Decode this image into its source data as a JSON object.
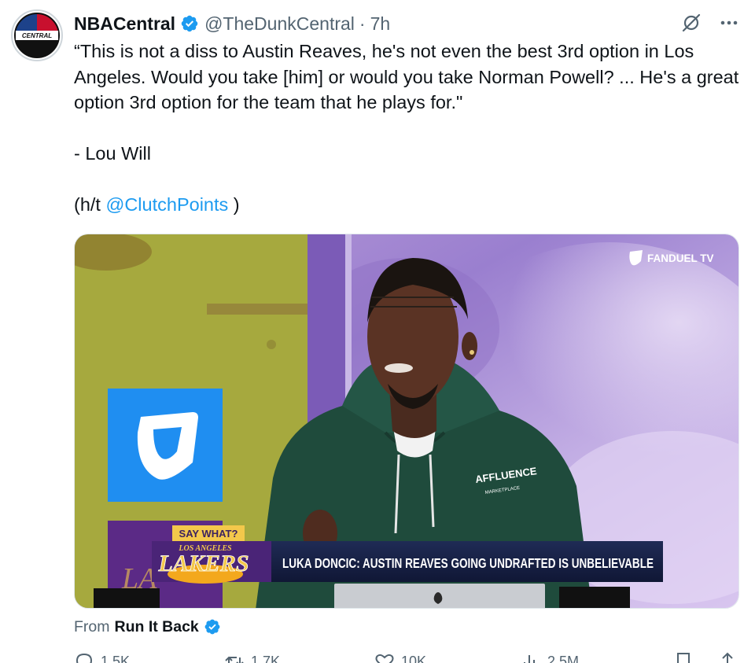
{
  "post": {
    "author_name": "NBACentral",
    "author_handle": "@TheDunkCentral",
    "separator": "·",
    "time": "7h",
    "avatar_text": "CENTRAL",
    "quote_text": "“This is not a diss to Austin Reaves, he's not even the best 3rd option in Los Angeles. Would you take [him] or would you take Norman Powell? ... He's a great option 3rd option for the team that he plays for.\"",
    "attribution": "- Lou Will",
    "ht_prefix": "(h/t ",
    "ht_mention": "@ClutchPoints",
    "ht_suffix": " )"
  },
  "media": {
    "brand_watermark": "FANDUEL TV",
    "hoodie_text": "AFFLUENCE",
    "hoodie_subtext": "MARKETPLACE",
    "lower_third_kicker": "SAY WHAT?",
    "team_logo_top": "LOS ANGELES",
    "team_logo_main": "LAKERS",
    "headline": "LUKA DONCIC: AUSTIN REAVES GOING UNDRAFTED IS UNBELIEVABLE"
  },
  "source": {
    "label": "From",
    "account": "Run It Back"
  },
  "actions": {
    "replies": "1.5K",
    "reposts": "1.7K",
    "likes": "10K",
    "views": "2.5M"
  },
  "colors": {
    "accent": "#1d9bf0",
    "text": "#0f1419",
    "secondary": "#536471"
  }
}
